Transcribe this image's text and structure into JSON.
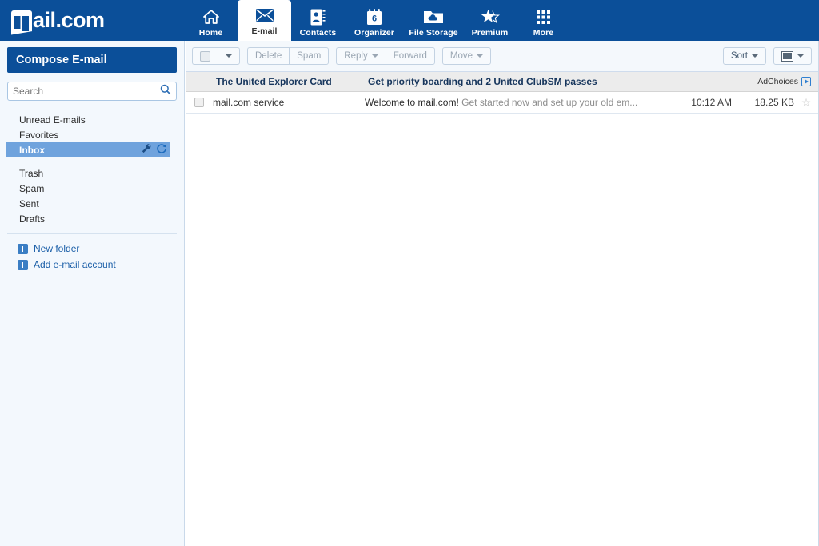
{
  "header": {
    "logo_text": "ail.com",
    "nav": [
      {
        "label": "Home",
        "icon": "home-icon",
        "active": false
      },
      {
        "label": "E-mail",
        "icon": "envelope-icon",
        "active": true
      },
      {
        "label": "Contacts",
        "icon": "contact-card-icon",
        "active": false
      },
      {
        "label": "Organizer",
        "icon": "calendar-icon",
        "active": false,
        "badge": "6"
      },
      {
        "label": "File Storage",
        "icon": "cloud-folder-icon",
        "active": false
      },
      {
        "label": "Premium",
        "icon": "star-icon",
        "active": false
      },
      {
        "label": "More",
        "icon": "grid-dots-icon",
        "active": false
      }
    ]
  },
  "sidebar": {
    "compose_label": "Compose E-mail",
    "search_placeholder": "Search",
    "folders": [
      {
        "label": "Unread E-mails",
        "selected": false
      },
      {
        "label": "Favorites",
        "selected": false
      },
      {
        "label": "Inbox",
        "selected": true
      },
      {
        "label": "Trash",
        "selected": false
      },
      {
        "label": "Spam",
        "selected": false
      },
      {
        "label": "Sent",
        "selected": false
      },
      {
        "label": "Drafts",
        "selected": false
      }
    ],
    "actions": [
      {
        "label": "New folder"
      },
      {
        "label": "Add e-mail account"
      }
    ]
  },
  "toolbar": {
    "delete_label": "Delete",
    "spam_label": "Spam",
    "reply_label": "Reply",
    "forward_label": "Forward",
    "move_label": "Move",
    "sort_label": "Sort"
  },
  "ad": {
    "title": "The United Explorer Card",
    "description": "Get priority boarding and 2 United ClubSM passes",
    "adchoices_label": "AdChoices"
  },
  "mail_list": {
    "messages": [
      {
        "sender": "mail.com service",
        "subject": "Welcome to mail.com!",
        "preview": " Get started now and set up your old em...",
        "time": "10:12 AM",
        "size": "18.25 KB",
        "starred": false
      }
    ]
  },
  "colors": {
    "brand_blue": "#0b4f99",
    "sidebar_bg": "#f3f8fd",
    "selected_folder": "#6fa3dd",
    "ad_bg": "#ececec"
  }
}
